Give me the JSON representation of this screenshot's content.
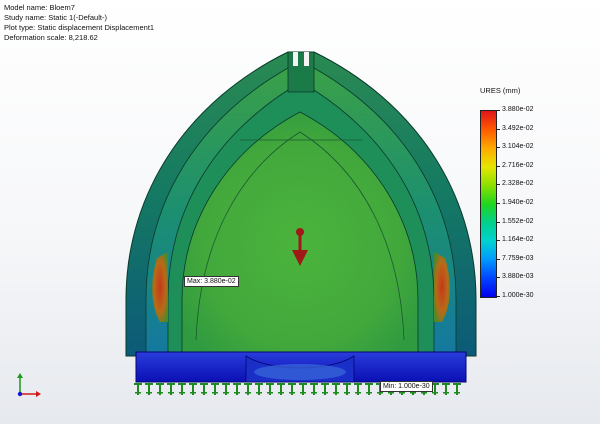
{
  "study_info": {
    "model_name": "Model name: Bloem7",
    "study_name": "Study name: Static 1(-Default-)",
    "plot_type": "Plot type: Static displacement Displacement1",
    "deformation_scale": "Deformation scale: 8,218.62"
  },
  "legend": {
    "title": "URES (mm)",
    "ticks": [
      "3.880e-02",
      "3.492e-02",
      "3.104e-02",
      "2.716e-02",
      "2.328e-02",
      "1.940e-02",
      "1.552e-02",
      "1.164e-02",
      "7.759e-03",
      "3.880e-03",
      "1.000e-30"
    ]
  },
  "callouts": {
    "max": "Max: 3.880e-02",
    "min": "Min: 1.000e-30"
  },
  "colors": {
    "outer_shell": "#1a6d4a",
    "inner_body": "#3fa83a",
    "base": "#1a1ad0",
    "fixture": "#1f8a1f",
    "load_arrow": "#a01818",
    "hotspot": "#c45018"
  },
  "icons": {
    "load": "force-arrow-icon",
    "fixture": "fixed-geometry-icon",
    "triad": "axis-triad-icon"
  }
}
